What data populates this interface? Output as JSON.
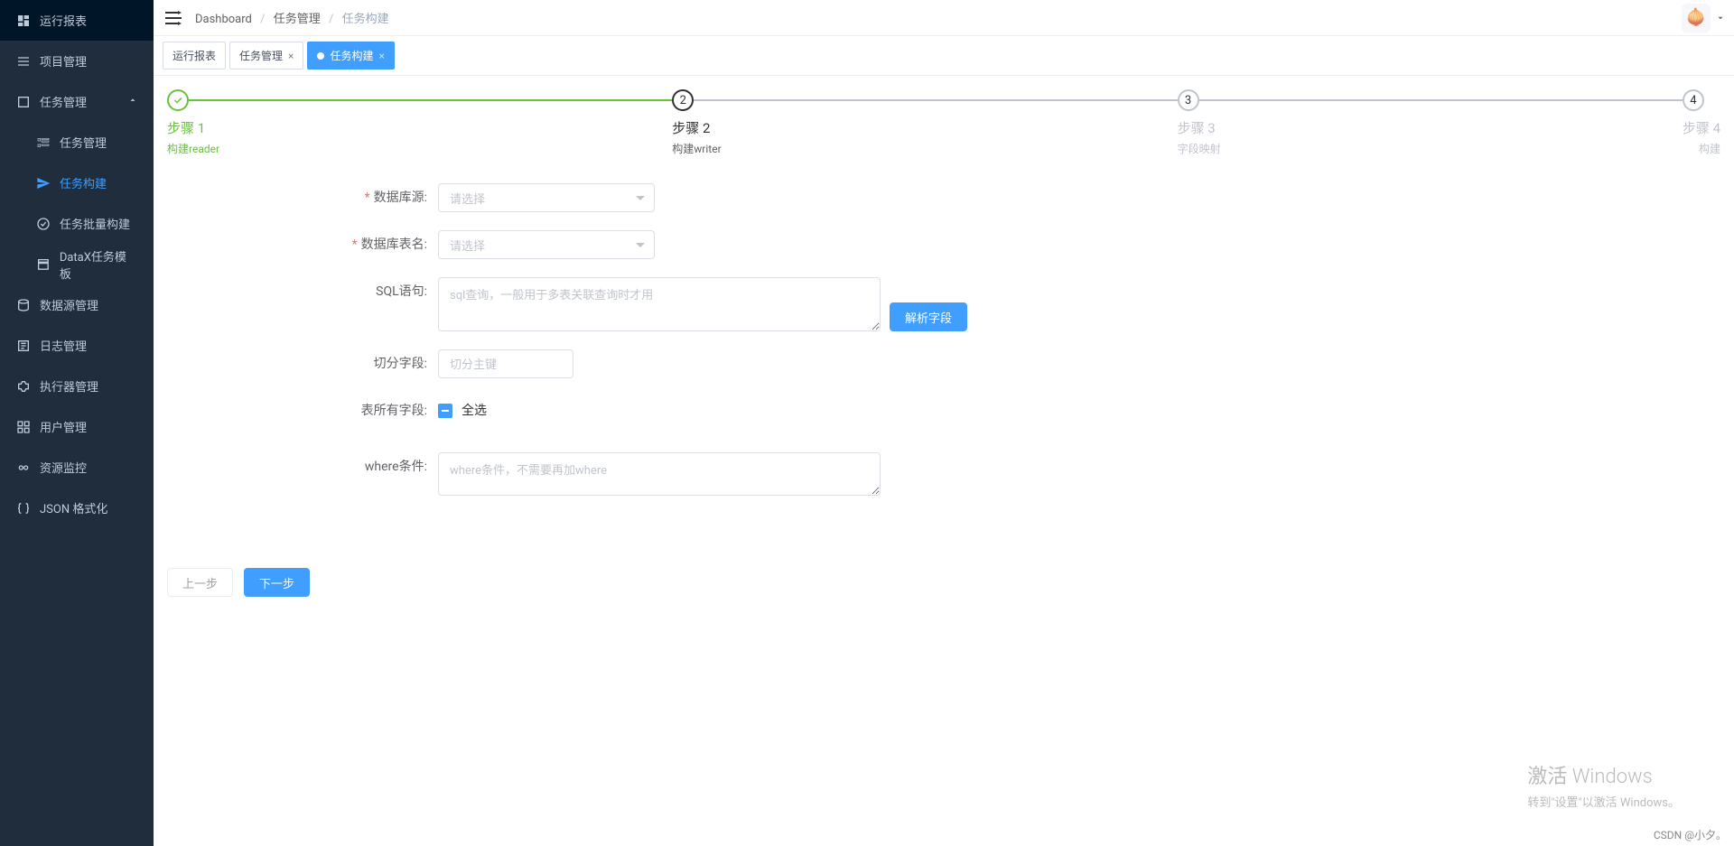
{
  "sidebar": {
    "items": [
      {
        "label": "运行报表"
      },
      {
        "label": "项目管理"
      },
      {
        "label": "任务管理",
        "expanded": true,
        "children": [
          {
            "label": "任务管理"
          },
          {
            "label": "任务构建",
            "active": true
          },
          {
            "label": "任务批量构建"
          },
          {
            "label": "DataX任务模板"
          }
        ]
      },
      {
        "label": "数据源管理"
      },
      {
        "label": "日志管理"
      },
      {
        "label": "执行器管理"
      },
      {
        "label": "用户管理"
      },
      {
        "label": "资源监控"
      },
      {
        "label": "JSON 格式化"
      }
    ]
  },
  "breadcrumb": {
    "root": "Dashboard",
    "parent": "任务管理",
    "current": "任务构建"
  },
  "tabs": [
    {
      "label": "运行报表",
      "closable": false,
      "active": false
    },
    {
      "label": "任务管理",
      "closable": true,
      "active": false
    },
    {
      "label": "任务构建",
      "closable": true,
      "active": true
    }
  ],
  "steps": [
    {
      "title": "步骤 1",
      "desc": "构建reader",
      "state": "completed"
    },
    {
      "title": "步骤 2",
      "desc": "构建writer",
      "state": "current"
    },
    {
      "title": "步骤 3",
      "desc": "字段映射",
      "state": "wait"
    },
    {
      "title": "步骤 4",
      "desc": "构建",
      "state": "wait"
    }
  ],
  "form": {
    "datasource": {
      "label": "数据库源:",
      "placeholder": "请选择",
      "required": true
    },
    "table": {
      "label": "数据库表名:",
      "placeholder": "请选择",
      "required": true
    },
    "sql": {
      "label": "SQL语句:",
      "placeholder": "sql查询，一般用于多表关联查询时才用"
    },
    "parse_btn": "解析字段",
    "split": {
      "label": "切分字段:",
      "placeholder": "切分主键"
    },
    "allfields": {
      "label": "表所有字段:",
      "checkbox_label": "全选"
    },
    "where": {
      "label": "where条件:",
      "placeholder": "where条件，不需要再加where"
    }
  },
  "actions": {
    "prev": "上一步",
    "next": "下一步"
  },
  "watermark": {
    "title": "激活 Windows",
    "sub": "转到\"设置\"以激活 Windows。"
  },
  "credit": "CSDN @小夕。"
}
